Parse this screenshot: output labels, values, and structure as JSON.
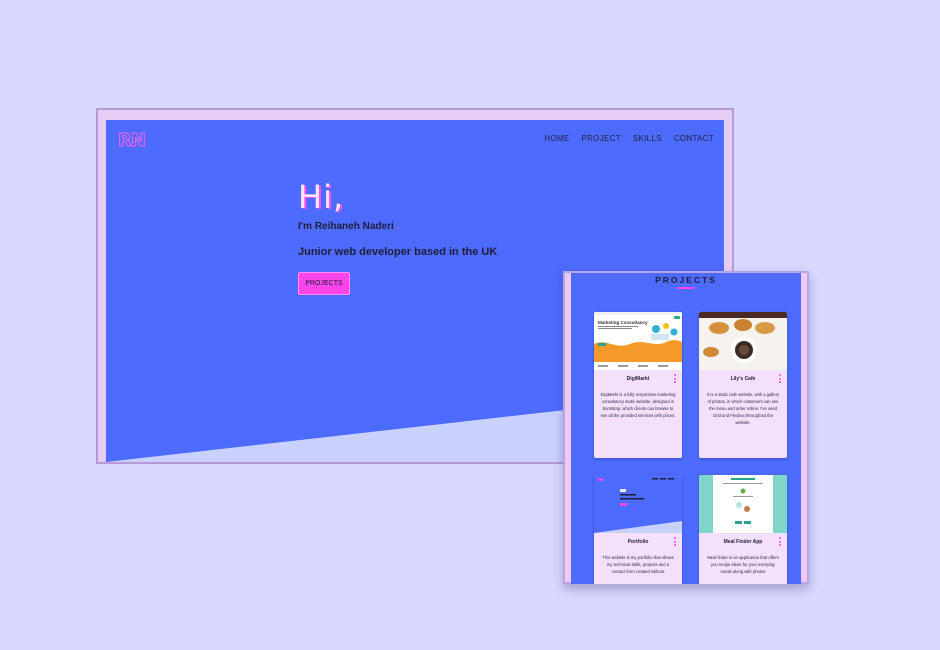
{
  "hero": {
    "logo": "RN",
    "nav": [
      "HOME",
      "PROJECT",
      "SKILLS",
      "CONTACT"
    ],
    "greeting": "Hi,",
    "intro": "I'm Reihaneh Naderi",
    "intro_dot": ".",
    "tagline": "Junior web developer based in the UK",
    "button": "PROJECTS"
  },
  "projects": {
    "title": "PROJECTS",
    "cards": [
      {
        "name": "DigiMarkt",
        "preview_heading": "Marketing Consultancy",
        "description": "DigiMarkt is a fully responsive marketing consultancy static website, designed in bootstrap, which clients can browse to see all the provided services with prices."
      },
      {
        "name": "Lily's Cafe",
        "description": "It is a static cafe website, with a gallery of photos, in which customers can see the menu and order online. I've used Grid and Flexbox throughout the website."
      },
      {
        "name": "Portfolio",
        "description": "This website is my portfolio that shows my technical skills, projects and a contact form created without"
      },
      {
        "name": "Meal Finder App",
        "description": "Meal finder is an application that offers you recipe ideas for your everyday meals along with photos"
      }
    ]
  },
  "colors": {
    "background": "#d9d8ff",
    "hero_blue": "#4e6bff",
    "accent_pink": "#ff45e9",
    "card_bg": "#f4e0fb",
    "wedge": "#c9d2ff"
  }
}
